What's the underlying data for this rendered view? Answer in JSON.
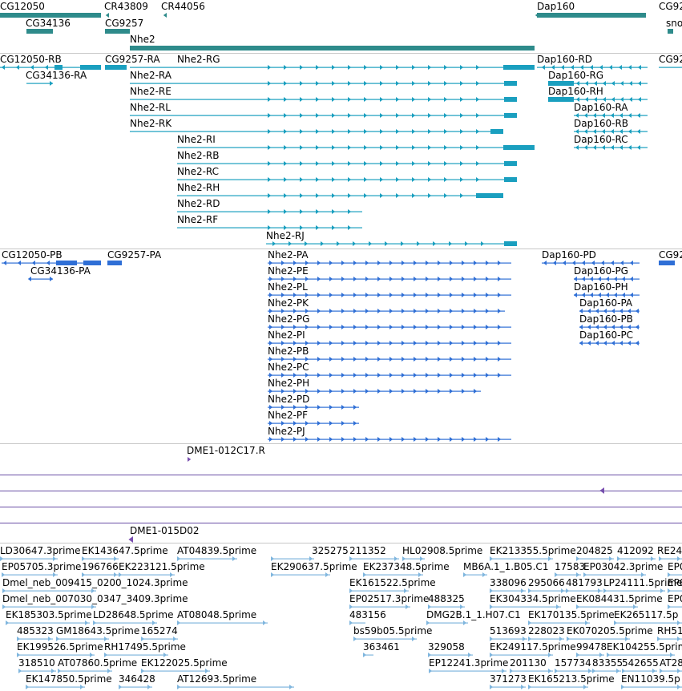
{
  "colors": {
    "gene": "#2e8b8b",
    "transcript_rg": "#1a9fbf",
    "protein": "#2f6fd6",
    "clone": "#7a4fb0",
    "est": "#7fb6de",
    "divider": "#c8c8c8"
  },
  "gene_track": {
    "labels": [
      "CG12050",
      "CR43809",
      "CR44056",
      "Dap160",
      "CG92",
      "CG34136",
      "CG9257",
      "sno",
      "Nhe2"
    ]
  },
  "transcript_track": {
    "labels": [
      "CG12050-RB",
      "CG9257-RA",
      "Nhe2-RG",
      "Dap160-RD",
      "CG92",
      "CG34136-RA",
      "Nhe2-RA",
      "Dap160-RG",
      "Nhe2-RE",
      "Dap160-RH",
      "Nhe2-RL",
      "Dap160-RA",
      "Nhe2-RK",
      "Dap160-RB",
      "Nhe2-RI",
      "Dap160-RC",
      "Nhe2-RB",
      "Nhe2-RC",
      "Nhe2-RH",
      "Nhe2-RD",
      "Nhe2-RF",
      "Nhe2-RJ"
    ]
  },
  "protein_track": {
    "labels": [
      "CG12050-PB",
      "CG9257-PA",
      "Nhe2-PA",
      "Dap160-PD",
      "CG92",
      "CG34136-PA",
      "Nhe2-PE",
      "Dap160-PG",
      "Nhe2-PL",
      "Dap160-PH",
      "Nhe2-PK",
      "Dap160-PA",
      "Nhe2-PG",
      "Dap160-PB",
      "Nhe2-PI",
      "Dap160-PC",
      "Nhe2-PB",
      "Nhe2-PC",
      "Nhe2-PH",
      "Nhe2-PD",
      "Nhe2-PF",
      "Nhe2-PJ"
    ]
  },
  "clone_track": {
    "labels": [
      "DME1-012C17.R",
      "DME1-015D02"
    ]
  },
  "est_track": {
    "labels": [
      "LD30647.3prime",
      "EK143647.5prime",
      "AT04839.5prime",
      "325275",
      "211352",
      "HL02908.5prime",
      "EK213355.5prime",
      "204825",
      "412092",
      "RE24",
      "EP05705.3prime",
      "196766",
      "EK223121.5prime",
      "EK290637.5prime",
      "EK237348.5prime",
      "MB6A.1_1.B05.C1",
      "17583",
      "EP03042.3prime",
      "EP0",
      "Dmel_neb_009415_0200_1024.3prime",
      "EK161522.5prime",
      "338096",
      "295066",
      "481793",
      "LP24111.5prime",
      "EP0",
      "Dmel_neb_007030_0347_3409.3prime",
      "EP02517.3prime",
      "488325",
      "EK304334.5prime",
      "EK084431.5prime",
      "EP0",
      "EK185303.5prime",
      "LD28648.5prime",
      "AT08048.5prime",
      "483156",
      "DMG2B.1_1.H07.C1",
      "EK170135.5prime",
      "EK265117.5p",
      "485323",
      "GM18643.5prime",
      "165274",
      "bs59b05.5prime",
      "513693",
      "228023",
      "EK070205.5prime",
      "RH51",
      "EK199526.5prime",
      "RH17495.5prime",
      "363461",
      "329058",
      "EK249117.5prime",
      "99478",
      "EK104255.5prime",
      "318510",
      "AT07860.5prime",
      "EK122025.5prime",
      "EP12241.3prime",
      "201130",
      "157734",
      "83355",
      "542655",
      "AT28",
      "EK147850.5prime",
      "346428",
      "AT12693.5prime",
      "371273",
      "EK165213.5prime",
      "EN11039.5p"
    ]
  }
}
